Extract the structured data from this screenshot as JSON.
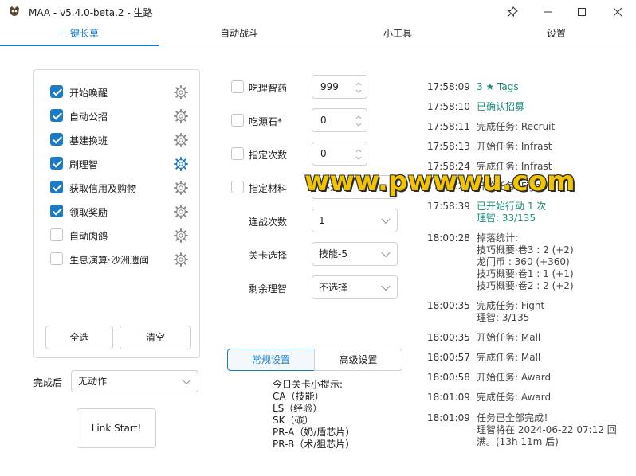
{
  "window": {
    "title": "MAA - v5.4.0-beta.2 - 生路"
  },
  "tabs": [
    {
      "label": "一键长草",
      "active": true
    },
    {
      "label": "自动战斗",
      "active": false
    },
    {
      "label": "小工具",
      "active": false
    },
    {
      "label": "设置",
      "active": false
    }
  ],
  "tasks": [
    {
      "label": "开始唤醒",
      "checked": true
    },
    {
      "label": "自动公招",
      "checked": true
    },
    {
      "label": "基建换班",
      "checked": true
    },
    {
      "label": "刷理智",
      "checked": true
    },
    {
      "label": "获取信用及购物",
      "checked": true
    },
    {
      "label": "领取奖励",
      "checked": true
    },
    {
      "label": "自动肉鸽",
      "checked": false
    },
    {
      "label": "生息演算·沙洲遗闻",
      "checked": false
    }
  ],
  "task_buttons": {
    "select_all": "全选",
    "clear": "清空"
  },
  "after_complete": {
    "label": "完成后",
    "value": "无动作"
  },
  "link_start": "Link Start!",
  "fight_options": {
    "medicine": {
      "label": "吃理智药",
      "value": "999",
      "checked": false
    },
    "stone": {
      "label": "吃源石*",
      "value": "0",
      "checked": false
    },
    "times": {
      "label": "指定次数",
      "value": "0",
      "checked": false
    },
    "material": {
      "label": "指定材料",
      "value": "不选择",
      "checked": false
    },
    "series": {
      "label": "连战次数",
      "value": "1"
    },
    "stage": {
      "label": "关卡选择",
      "value": "技能-5"
    },
    "remaining": {
      "label": "剩余理智",
      "value": "不选择"
    }
  },
  "settings_tabs": [
    {
      "label": "常规设置",
      "active": true
    },
    {
      "label": "高级设置",
      "active": false
    }
  ],
  "tips": {
    "title": "今日关卡小提示:",
    "lines": [
      "CA（技能）",
      "LS（经验）",
      "SK（碳）",
      "PR-A（奶/盾芯片）",
      "PR-B（术/狙芯片）"
    ]
  },
  "log": [
    {
      "time": "17:58:09",
      "msg": "3 ★ Tags",
      "color": "green"
    },
    {
      "time": "17:58:10",
      "msg": "已确认招募",
      "color": "green"
    },
    {
      "time": "17:58:11",
      "msg": "完成任务: Recruit",
      "color": "normal"
    },
    {
      "time": "17:58:13",
      "msg": "开始任务: Infrast",
      "color": "normal"
    },
    {
      "time": "17:58:24",
      "msg": "完成任务: Infrast",
      "color": "normal"
    },
    {
      "time": "17:58:24",
      "msg": "开始任务: Fight",
      "color": "normal"
    },
    {
      "time": "17:58:39",
      "msg": "已开始行动 1 次\n理智: 33/135",
      "color": "green"
    },
    {
      "time": "18:00:28",
      "msg": "掉落统计:\n技巧概要·卷3 : 2 (+2)\n龙门币 : 360 (+360)\n技巧概要·卷1 : 1 (+1)\n技巧概要·卷2 : 2 (+2)",
      "color": "normal"
    },
    {
      "time": "18:00:35",
      "msg": "完成任务: Fight\n理智: 3/135",
      "color": "normal"
    },
    {
      "time": "18:00:35",
      "msg": "开始任务: Mall",
      "color": "normal"
    },
    {
      "time": "18:00:57",
      "msg": "完成任务: Mall",
      "color": "normal"
    },
    {
      "time": "18:00:58",
      "msg": "开始任务: Award",
      "color": "normal"
    },
    {
      "time": "18:01:09",
      "msg": "完成任务: Award",
      "color": "normal"
    },
    {
      "time": "18:01:09",
      "msg": "任务已全部完成！\n理智将在 2024-06-22 07:12 回满。(13h 11m 后)",
      "color": "normal"
    }
  ],
  "watermark": "www.pwwwu.com",
  "colors": {
    "accent": "#1a7cc9",
    "log_green": "#1a8a7a"
  }
}
